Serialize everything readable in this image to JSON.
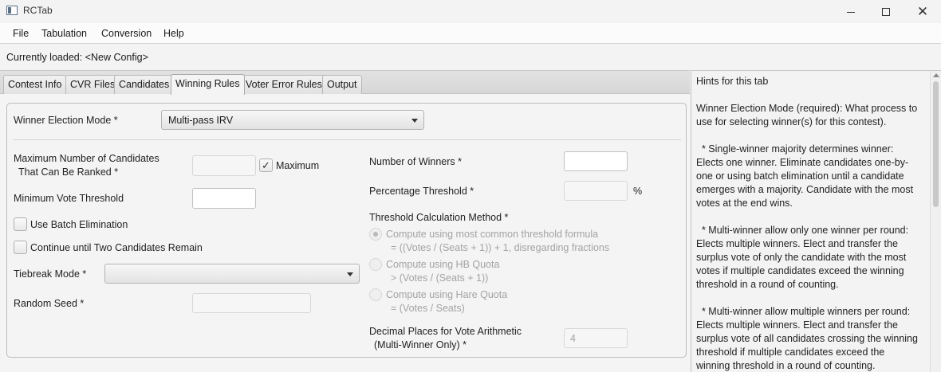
{
  "window": {
    "title": "RCTab",
    "minimize_icon": "minimize-icon",
    "maximize_icon": "maximize-icon",
    "close_icon": "close-icon",
    "close_glyph": "✕"
  },
  "menu": {
    "items": [
      "File",
      "Tabulation",
      "Conversion",
      "Help"
    ]
  },
  "status": {
    "loaded": "Currently loaded: <New Config>"
  },
  "tabs": {
    "items": [
      "Contest Info",
      "CVR Files",
      "Candidates",
      "Winning Rules",
      "Voter Error Rules",
      "Output"
    ],
    "active": "Winning Rules"
  },
  "form": {
    "winner_mode_label": "Winner Election Mode *",
    "winner_mode_value": "Multi-pass IRV",
    "max_candidates_label_1": "Maximum Number of Candidates",
    "max_candidates_label_2": "That Can Be Ranked *",
    "max_candidates_value": "",
    "maximum_checkbox_label": "Maximum",
    "maximum_checked": true,
    "check_glyph": "✓",
    "min_vote_label": "Minimum Vote Threshold",
    "min_vote_value": "",
    "batch_elimination_label": "Use Batch Elimination",
    "continue_label": "Continue until Two Candidates Remain",
    "tiebreak_label": "Tiebreak Mode *",
    "tiebreak_value": "",
    "random_seed_label": "Random Seed *",
    "random_seed_value": "",
    "num_winners_label": "Number of Winners *",
    "num_winners_value": "",
    "percentage_label": "Percentage Threshold *",
    "percentage_value": "",
    "percent_sign": "%",
    "threshold_method_label": "Threshold Calculation Method *",
    "threshold_options": [
      {
        "label": "Compute using most common threshold formula",
        "sub": "= ((Votes / (Seats + 1)) + 1, disregarding fractions",
        "selected": true
      },
      {
        "label": "Compute using HB Quota",
        "sub": "> (Votes / (Seats + 1))",
        "selected": false
      },
      {
        "label": "Compute using Hare Quota",
        "sub": "= (Votes / Seats)",
        "selected": false
      }
    ],
    "decimal_label_1": "Decimal Places for Vote Arithmetic",
    "decimal_label_2": "(Multi-Winner Only) *",
    "decimal_value": "4"
  },
  "hints": {
    "title": "Hints for this tab",
    "paragraphs": [
      "Winner Election Mode (required): What process to use for selecting winner(s) for this contest).",
      "  * Single-winner majority determines winner: Elects one winner. Eliminate candidates one-by-one or using batch elimination until a candidate emerges with a majority. Candidate with the most votes at the end wins.",
      "  * Multi-winner allow only one winner per round: Elects multiple winners. Elect and transfer the surplus vote of only the candidate with the most votes if multiple candidates exceed the winning threshold in a round of counting.",
      "  * Multi-winner allow multiple winners per round: Elects multiple winners. Elect and transfer the surplus vote of all candidates crossing the winning threshold if multiple candidates exceed the winning threshold in a round of counting."
    ]
  }
}
